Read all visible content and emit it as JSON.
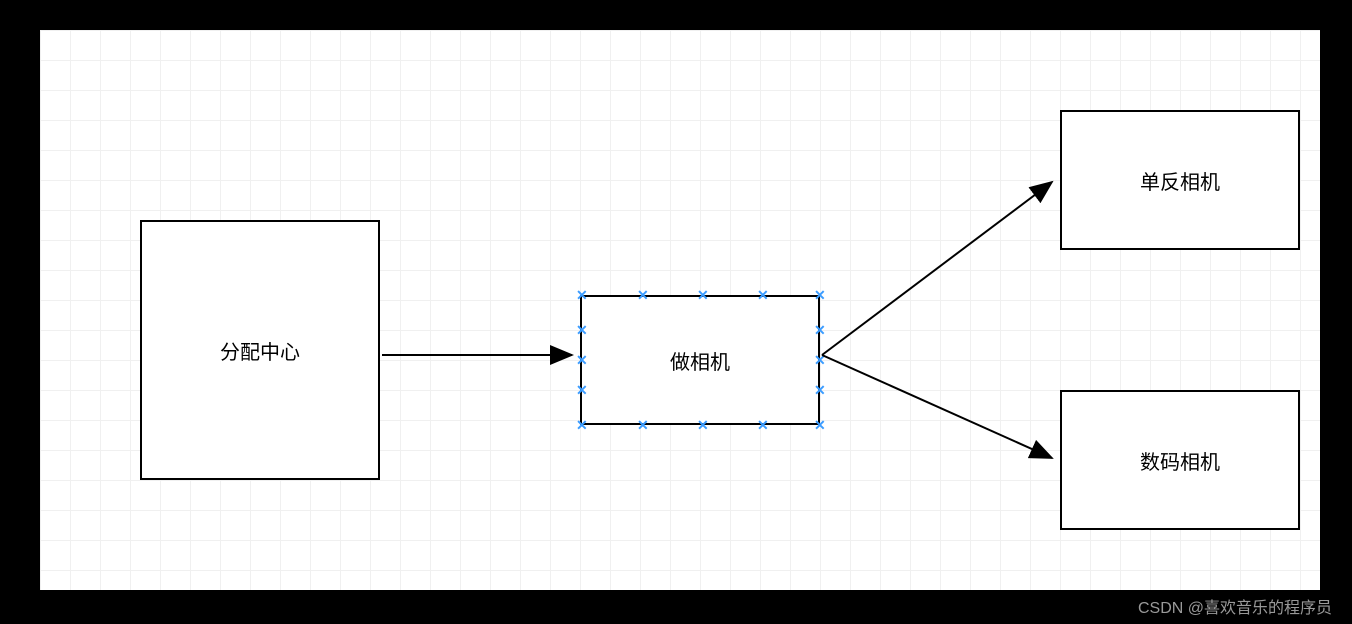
{
  "nodes": {
    "distribution": {
      "label": "分配中心"
    },
    "make_camera": {
      "label": "做相机"
    },
    "slr_camera": {
      "label": "单反相机"
    },
    "digital_camera": {
      "label": "数码相机"
    }
  },
  "watermark": "CSDN @喜欢音乐的程序员",
  "selected_node": "make_camera",
  "colors": {
    "handle": "#3b9cff",
    "border": "#000000",
    "grid": "#f0f0f0"
  }
}
